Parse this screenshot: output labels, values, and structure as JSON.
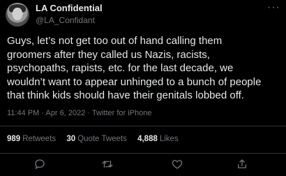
{
  "user": {
    "name": "LA Confidential",
    "handle": "@LA_Confidant"
  },
  "tweet": {
    "text": "Guys, let’s not get too out of hand calling them\ngroomers after they called us Nazis, racists,\npsychopaths, rapists, etc. for the last decade, we\nwouldn’t want to appear unhinged to a bunch of people\nthat think kids should have their genitals lobbed off.",
    "meta": "11:44 PM · Apr 6, 2022 · Twitter for iPhone"
  },
  "stats": {
    "retweets_count": "989",
    "retweets_label": "Retweets",
    "quotes_count": "30",
    "quotes_label": "Quote Tweets",
    "likes_count": "4,888",
    "likes_label": "Likes"
  },
  "more_glyph": "···",
  "icons": [
    "reply-icon",
    "retweet-icon",
    "like-icon",
    "share-icon"
  ],
  "colors": {
    "background": "#000000",
    "text": "#e7e9ea",
    "secondary": "#71767b",
    "divider": "#2f3336"
  }
}
